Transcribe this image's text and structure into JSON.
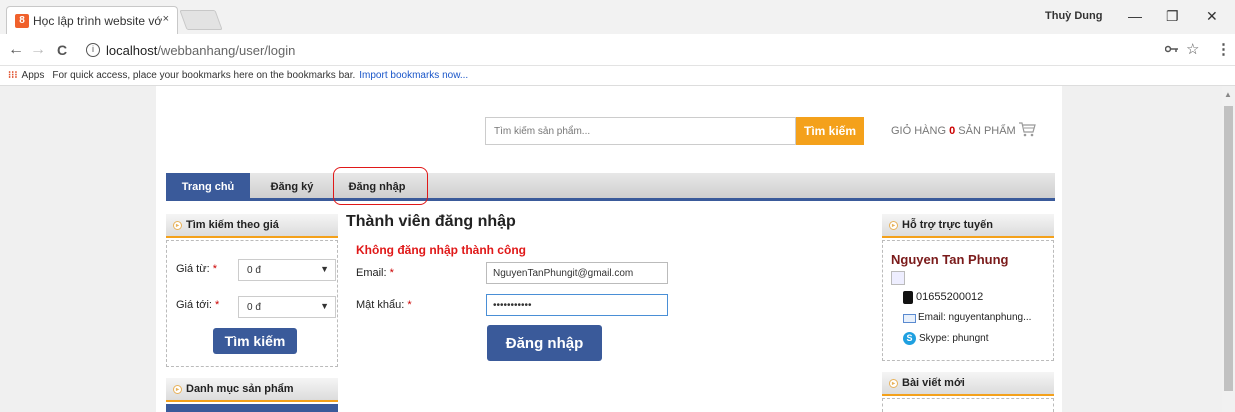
{
  "browser": {
    "tab_title": "Học lập trình website vớ",
    "tab_close": "×",
    "user": "Thuỳ Dung",
    "minimize": "—",
    "restore": "❐",
    "close": "✕",
    "back": "←",
    "forward": "→",
    "reload": "C",
    "url_host": "localhost",
    "url_path": "/webbanhang/user/login",
    "bookmarks_apps": "Apps",
    "bookmarks_text": "For quick access, place your bookmarks here on the bookmarks bar.",
    "bookmarks_link": "Import bookmarks now...",
    "key_icon": "key-icon",
    "star_icon": "star-icon"
  },
  "header": {
    "search_placeholder": "Tìm kiếm sản phẩm...",
    "search_button": "Tìm kiếm",
    "cart_prefix": "GIỎ HÀNG",
    "cart_count": "0",
    "cart_suffix": "SẢN PHẨM"
  },
  "menu": {
    "home": "Trang chủ",
    "register": "Đăng ký",
    "login": "Đăng nhập"
  },
  "price_search": {
    "title": "Tìm kiếm theo giá",
    "from_label": "Giá từ:",
    "from_value": "0 đ",
    "to_label": "Giá tới:",
    "to_value": "0 đ",
    "button": "Tìm kiếm",
    "required": "*"
  },
  "categories": {
    "title": "Danh mục sản phẩm"
  },
  "login": {
    "title": "Thành viên đăng nhập",
    "error": "Không đăng nhập thành công",
    "email_label": "Email:",
    "email_value": "NguyenTanPhungit@gmail.com",
    "password_label": "Mật khẩu:",
    "password_value": "•••••••••••",
    "required": "*",
    "button": "Đăng nhập"
  },
  "support": {
    "title": "Hỗ trợ trực tuyến",
    "name": "Nguyen Tan Phung",
    "phone": "01655200012",
    "email": "Email: nguyentanphung...",
    "skype": "Skype: phungnt"
  },
  "news": {
    "title": "Bài viết mới"
  },
  "colors": {
    "accent": "#f4a11b",
    "primary": "#3a5a9a",
    "error": "#e01818"
  }
}
